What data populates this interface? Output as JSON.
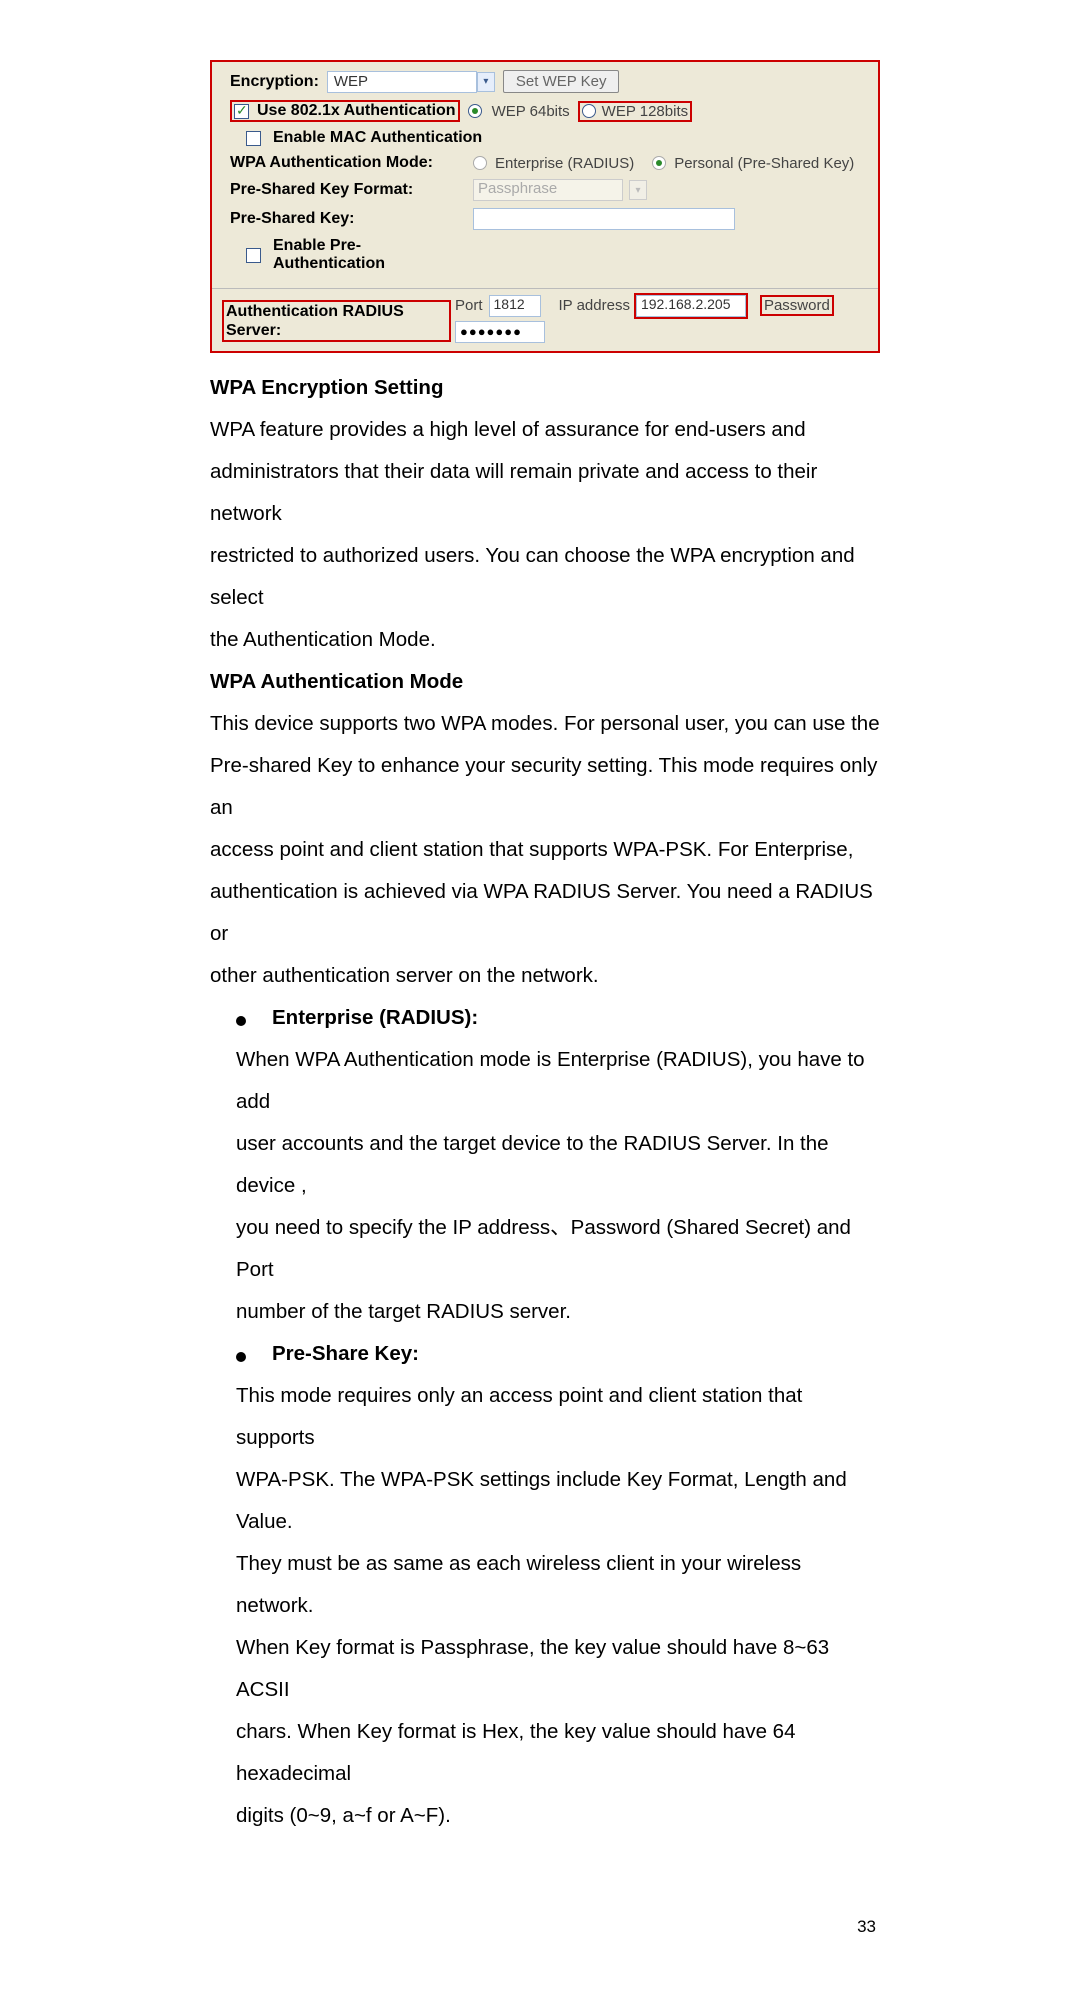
{
  "screenshot": {
    "encryption_label": "Encryption:",
    "encryption_value": "WEP",
    "setwep_btn": "Set WEP Key",
    "use8021x_label": "Use 802.1x Authentication",
    "wep64": "WEP 64bits",
    "wep128": "WEP 128bits",
    "enable_mac": "Enable MAC Authentication",
    "wpa_auth_mode": "WPA Authentication Mode:",
    "enterprise": "Enterprise (RADIUS)",
    "personal": "Personal (Pre-Shared Key)",
    "psk_format": "Pre-Shared Key Format:",
    "passphrase": "Passphrase",
    "psk": "Pre-Shared Key:",
    "enable_pre": "Enable Pre-Authentication",
    "auth_radius": "Authentication RADIUS Server:",
    "port_label": "Port",
    "port_value": "1812",
    "ip_label": "IP address",
    "ip_value": "192.168.2.205",
    "pwd_label": "Password",
    "pwd_dots": "●●●●●●●"
  },
  "doc": {
    "h1": "WPA Encryption Setting",
    "p1a": "WPA feature provides a high level of assurance for end-users and",
    "p1b": "administrators that their data will remain private and access to their network",
    "p1c": "restricted to authorized users. You can choose the WPA encryption and select",
    "p1d": "the Authentication Mode.",
    "h2": "WPA Authentication Mode",
    "p2a": "This device supports two WPA modes. For personal user, you can use the",
    "p2b": "Pre-shared Key to enhance your security setting. This mode requires only an",
    "p2c": "access point and client station that supports WPA-PSK. For Enterprise,",
    "p2d": "authentication is achieved via WPA RADIUS Server. You need a RADIUS or",
    "p2e": "other authentication server on the network.",
    "b1": "Enterprise (RADIUS):",
    "e1": "When WPA Authentication mode is Enterprise (RADIUS), you have to add",
    "e2": "user accounts and the target device to the RADIUS Server. In the device ,",
    "e3": "you need to specify the IP address、Password (Shared Secret) and Port",
    "e4": "number of the target RADIUS server.",
    "b2": "Pre-Share Key:",
    "s1": "This mode requires only an access point and client station that supports",
    "s2": "WPA-PSK. The WPA-PSK settings include Key Format, Length and Value.",
    "s3": "They must be as same as each wireless client in your wireless network.",
    "s4": "When Key format is Passphrase, the key value should have 8~63 ACSII",
    "s5": "chars. When Key format is Hex, the key value should have 64 hexadecimal",
    "s6": "digits (0~9, a~f or A~F).",
    "page": "33"
  }
}
